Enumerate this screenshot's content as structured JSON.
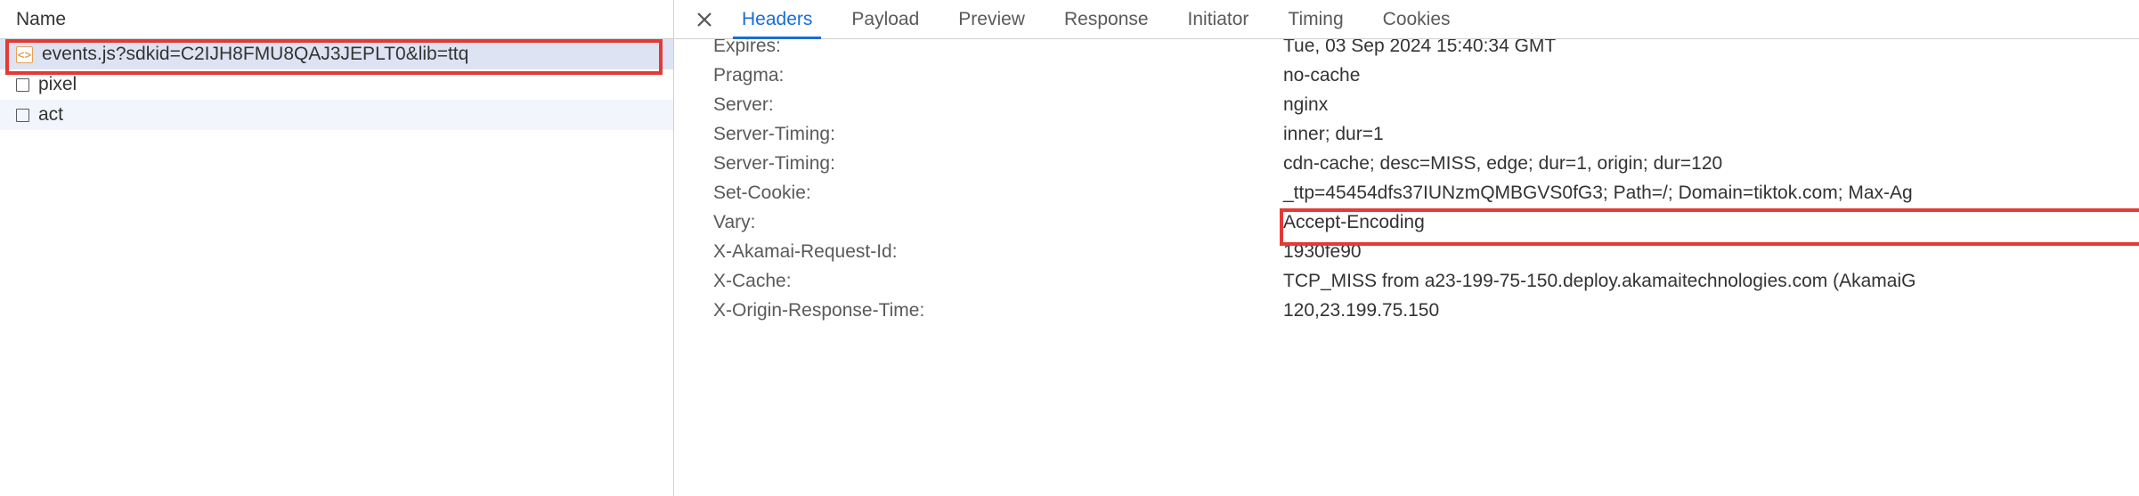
{
  "left": {
    "header": "Name",
    "rows": [
      {
        "kind": "js",
        "label": "events.js?sdkid=C2IJH8FMU8QAJ3JEPLT0&lib=ttq"
      },
      {
        "kind": "other",
        "label": "pixel"
      },
      {
        "kind": "other",
        "label": "act"
      }
    ]
  },
  "tabs": {
    "items": [
      "Headers",
      "Payload",
      "Preview",
      "Response",
      "Initiator",
      "Timing",
      "Cookies"
    ],
    "active": 0
  },
  "headers": [
    {
      "name": "Expires:",
      "value": "Tue, 03 Sep 2024 15:40:34 GMT"
    },
    {
      "name": "Pragma:",
      "value": "no-cache"
    },
    {
      "name": "Server:",
      "value": "nginx"
    },
    {
      "name": "Server-Timing:",
      "value": "inner; dur=1"
    },
    {
      "name": "Server-Timing:",
      "value": "cdn-cache; desc=MISS, edge; dur=1, origin; dur=120"
    },
    {
      "name": "Set-Cookie:",
      "value": "_ttp=45454dfs37IUNzmQMBGVS0fG3; Path=/; Domain=tiktok.com; Max-Ag"
    },
    {
      "name": "Vary:",
      "value": "Accept-Encoding"
    },
    {
      "name": "X-Akamai-Request-Id:",
      "value": "1930fe90"
    },
    {
      "name": "X-Cache:",
      "value": "TCP_MISS from a23-199-75-150.deploy.akamaitechnologies.com (AkamaiG"
    },
    {
      "name": "X-Origin-Response-Time:",
      "value": "120,23.199.75.150"
    }
  ]
}
